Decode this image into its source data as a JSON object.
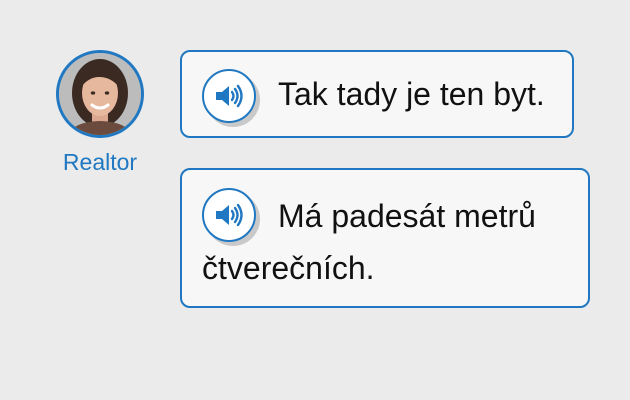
{
  "speaker": {
    "name": "Realtor",
    "avatar_icon": "woman-portrait"
  },
  "dialogue": [
    {
      "text": "Tak tady je ten byt.",
      "audio_icon": "speaker-icon"
    },
    {
      "text": "Má padesát metrů čtverečních.",
      "audio_icon": "speaker-icon"
    }
  ],
  "colors": {
    "accent": "#1f78c1",
    "background": "#ebebeb",
    "bubble": "#f7f7f7"
  }
}
